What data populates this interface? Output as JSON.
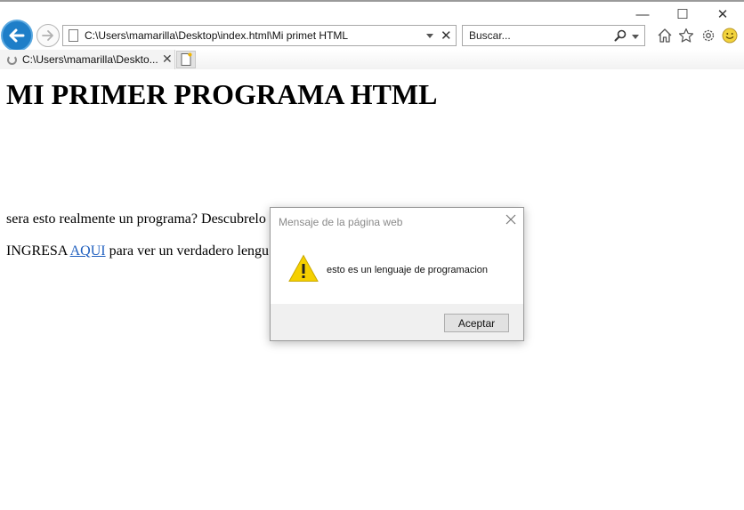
{
  "window": {
    "minimize": "—",
    "maximize": "☐",
    "close": "✕"
  },
  "toolbar": {
    "address": "C:\\Users\\mamarilla\\Desktop\\index.html\\Mi primet HTML",
    "search_placeholder": "Buscar...",
    "stop_glyph": "✕"
  },
  "tab": {
    "label": "C:\\Users\\mamarilla\\Deskto...",
    "close_glyph": "✕"
  },
  "page": {
    "heading": "MI PRIMER PROGRAMA HTML",
    "line1": "sera esto realmente un programa? Descubrelo .",
    "line2_prefix": "INGRESA ",
    "line2_link": "AQUI",
    "line2_suffix": " para ver un verdadero lengu"
  },
  "dialog": {
    "title": "Mensaje de la página web",
    "message": "esto es un lenguaje de programacion",
    "ok_label": "Aceptar"
  },
  "colors": {
    "accent_blue": "#1e7ec8",
    "warning_yellow": "#f5d000",
    "link_blue": "#1f5fbf"
  }
}
